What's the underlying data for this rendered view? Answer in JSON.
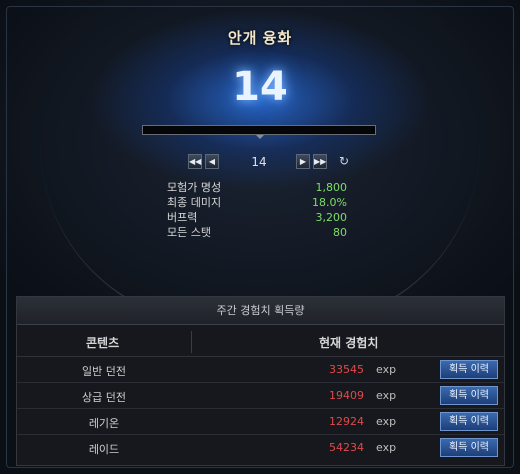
{
  "title": "안개 융화",
  "level": "14",
  "progress": 0.0,
  "nav": {
    "first_icon": "◀◀",
    "prev_icon": "◀",
    "level": "14",
    "next_icon": "▶",
    "last_icon": "▶▶",
    "reset_icon": "↻"
  },
  "stats": [
    {
      "name": "모험가 명성",
      "value": "1,800"
    },
    {
      "name": "최종 데미지",
      "value": "18.0%"
    },
    {
      "name": "버프력",
      "value": "3,200"
    },
    {
      "name": "모든 스탯",
      "value": "80"
    }
  ],
  "weekly_panel": {
    "title": "주간 경험치 획득량",
    "col_content": "콘텐츠",
    "col_exp": "현재 경험치",
    "rows": [
      {
        "name": "일반 던전",
        "value": "33545",
        "unit": "exp",
        "button": "획득 이력"
      },
      {
        "name": "상급 던전",
        "value": "19409",
        "unit": "exp",
        "button": "획득 이력"
      },
      {
        "name": "레기온",
        "value": "12924",
        "unit": "exp",
        "button": "획득 이력"
      },
      {
        "name": "레이드",
        "value": "54234",
        "unit": "exp",
        "button": "획득 이력"
      }
    ]
  },
  "colors": {
    "stat_value": "#7fdc6a",
    "exp_value": "#e04a4a",
    "button": "#2a5596",
    "title": "#f2e6c9"
  }
}
